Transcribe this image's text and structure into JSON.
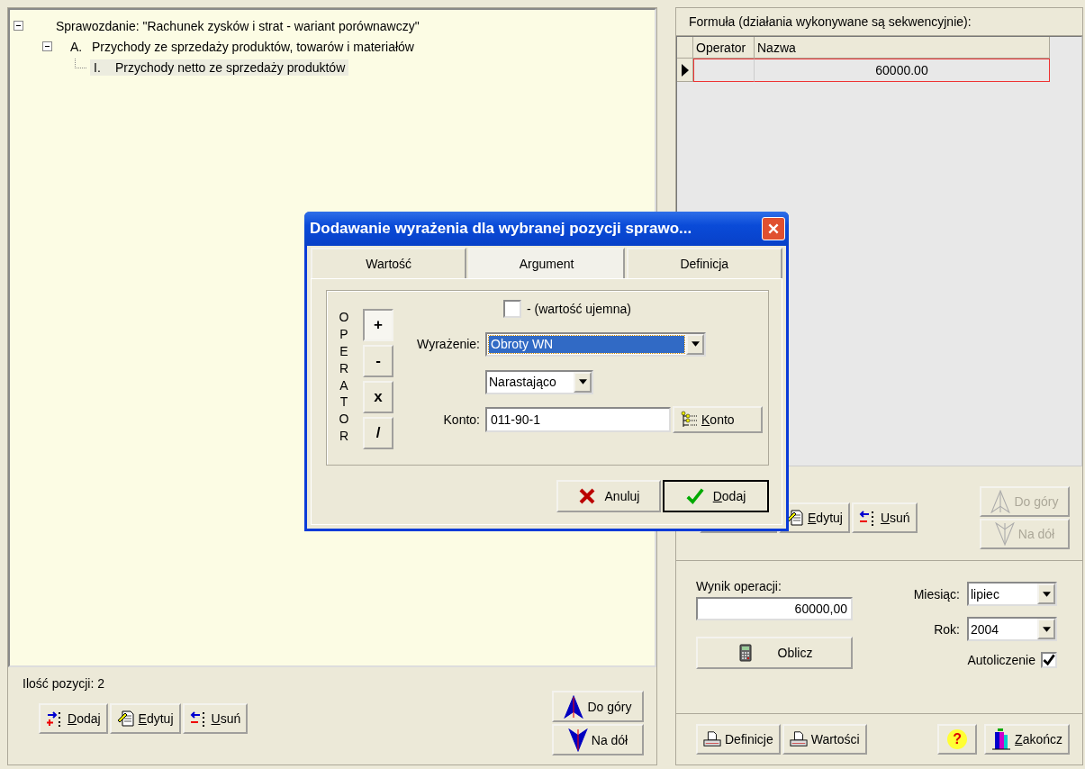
{
  "tree": {
    "label": "Sprawozdanie: \"Rachunek zysków i strat - wariant porównawczy\"",
    "expanded": true,
    "selected": false,
    "children": [
      {
        "marker": "A.",
        "label": "Przychody ze sprzedaży produktów, towarów i materiałów",
        "expanded": true,
        "selected": false,
        "children": [
          {
            "marker": "I.",
            "label": "Przychody netto ze sprzedaży produktów",
            "selected": true
          }
        ]
      }
    ]
  },
  "item_count": "Ilość pozycji: 2",
  "left_buttons": [
    {
      "label": "Dodaj",
      "mnemonic": true
    },
    {
      "label": "Edytuj",
      "mnemonic": true
    },
    {
      "label": "Usuń",
      "mnemonic": true
    }
  ],
  "left_move_buttons": [
    {
      "label": "Do góry",
      "disabled": false
    },
    {
      "label": "Na dół",
      "disabled": false
    }
  ],
  "formula": {
    "title": "Formuła (działania wykonywane są sekwencyjnie):",
    "columns": [
      "Operator",
      "Nazwa"
    ],
    "rows": [
      {
        "value": "60000.00",
        "selected": true
      }
    ]
  },
  "formula_buttons": [
    {
      "label": "Edytuj",
      "mnemonic": true
    },
    {
      "label": "Usuń",
      "mnemonic": true
    }
  ],
  "formula_move_buttons": [
    {
      "label": "Do góry",
      "disabled": true
    },
    {
      "label": "Na dół",
      "disabled": true
    }
  ],
  "result": {
    "label": "Wynik operacji:",
    "value": "60000,00",
    "calc_button": "Oblicz",
    "month_label": "Miesiąc:",
    "month": "lipiec",
    "year_label": "Rok:",
    "year": "2004",
    "auto_label": "Autoliczenie",
    "auto_checked": true
  },
  "bottom_buttons": [
    {
      "label": "Definicje",
      "mnemonic": false
    },
    {
      "label": "Wartości",
      "mnemonic": false
    }
  ],
  "help_button": "?",
  "close_button": {
    "label": "Zakończ",
    "mnemonic": true
  },
  "dialog": {
    "title": "Dodawanie wyrażenia dla wybranej pozycji sprawo...",
    "tabs": [
      {
        "label": "Wartość",
        "selected": false
      },
      {
        "label": "Argument",
        "selected": true
      },
      {
        "label": "Definicja",
        "selected": false
      }
    ],
    "operator_label": "OPERATOR",
    "operators": [
      {
        "label": "+",
        "selected": true
      },
      {
        "label": "-",
        "selected": false
      },
      {
        "label": "x",
        "selected": false
      },
      {
        "label": "/",
        "selected": false
      }
    ],
    "negative": {
      "label": "- (wartość ujemna)",
      "checked": false
    },
    "expression": {
      "label": "Wyrażenie:",
      "value": "Obroty WN"
    },
    "mode": {
      "value": "Narastająco"
    },
    "account": {
      "label": "Konto:",
      "value": "011-90-1",
      "button": "Konto"
    },
    "buttons": [
      {
        "label": "Anuluj",
        "default": false,
        "mnemonic": false
      },
      {
        "label": "Dodaj",
        "default": true,
        "mnemonic": true
      }
    ]
  }
}
